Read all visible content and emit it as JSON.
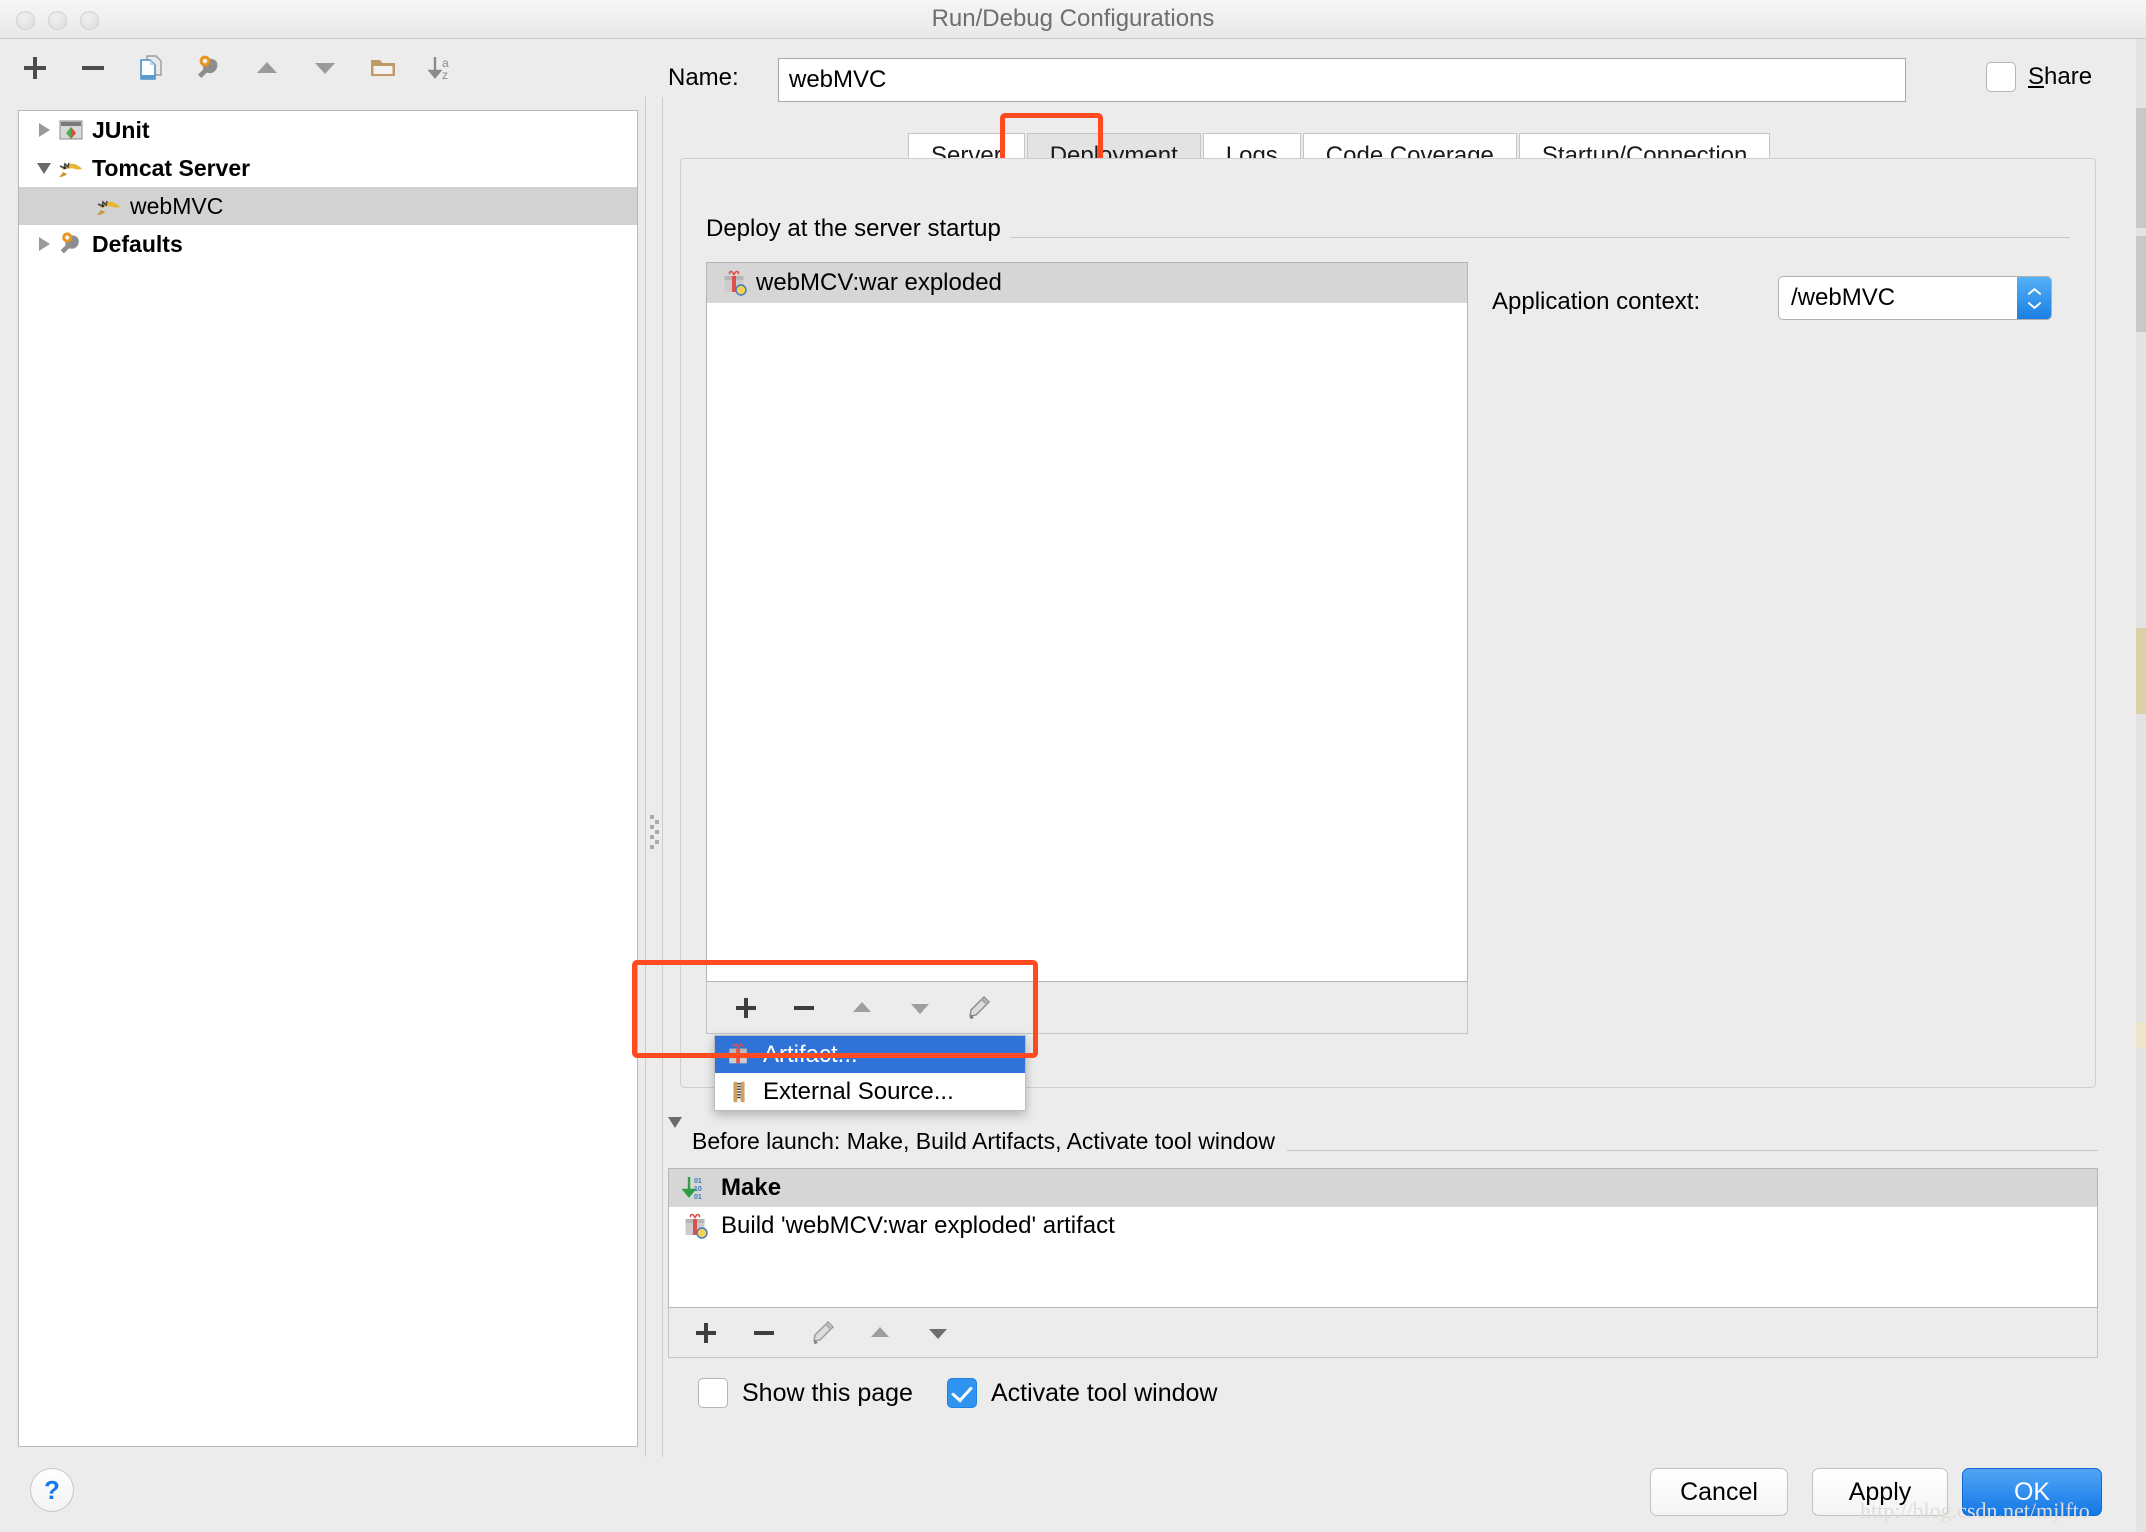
{
  "window": {
    "title": "Run/Debug Configurations",
    "traffic_lights": [
      "close-button",
      "minimize-button",
      "zoom-button"
    ]
  },
  "left_toolbar": {
    "buttons": [
      {
        "name": "add-configuration-button",
        "icon": "plus-icon",
        "label": "+"
      },
      {
        "name": "remove-configuration-button",
        "icon": "minus-icon",
        "label": "−"
      },
      {
        "name": "copy-configuration-button",
        "icon": "copy-icon",
        "label": "Copy Configuration"
      },
      {
        "name": "edit-defaults-button",
        "icon": "wrench-icon",
        "label": "Edit defaults"
      },
      {
        "name": "move-up-button",
        "icon": "triangle-up-icon",
        "label": "Move Up"
      },
      {
        "name": "move-down-button",
        "icon": "triangle-down-icon",
        "label": "Move Down"
      },
      {
        "name": "create-folder-button",
        "icon": "folder-icon",
        "label": "Create New Folder"
      },
      {
        "name": "sort-configurations-button",
        "icon": "sort-az-icon",
        "label": "Sort Configurations"
      }
    ]
  },
  "tree": {
    "items": [
      {
        "label": "JUnit",
        "icon": "junit-icon",
        "twisty": "right",
        "indent": 0,
        "bold": true,
        "selected": false
      },
      {
        "label": "Tomcat Server",
        "icon": "tomcat-icon",
        "twisty": "down",
        "indent": 0,
        "bold": true,
        "selected": false
      },
      {
        "label": "webMVC",
        "icon": "tomcat-icon",
        "twisty": "none",
        "indent": 1,
        "bold": false,
        "selected": true
      },
      {
        "label": "Defaults",
        "icon": "wrench-icon",
        "twisty": "right",
        "indent": 0,
        "bold": true,
        "selected": false
      }
    ]
  },
  "name_row": {
    "label": "Name:",
    "value": "webMVC",
    "placeholder": "",
    "share_label_prefix": "",
    "share_mnemonic": "S",
    "share_label_rest": "hare",
    "share_checked": false
  },
  "tabs": [
    {
      "label": "Server",
      "active": false
    },
    {
      "label": "Deployment",
      "active": true,
      "highlighted": true
    },
    {
      "label": "Logs",
      "active": false
    },
    {
      "label": "Code Coverage",
      "active": false
    },
    {
      "label": "Startup/Connection",
      "active": false
    }
  ],
  "deployment": {
    "section_title": "Deploy at the server startup",
    "items": [
      {
        "label": "webMCV:war exploded",
        "icon": "artifact-icon",
        "selected": true
      }
    ],
    "toolbar": [
      {
        "name": "add-artifact-button",
        "icon": "plus-icon"
      },
      {
        "name": "remove-artifact-button",
        "icon": "minus-icon"
      },
      {
        "name": "move-artifact-up-button",
        "icon": "triangle-up-icon"
      },
      {
        "name": "move-artifact-down-button",
        "icon": "triangle-down-icon"
      },
      {
        "name": "edit-artifact-button",
        "icon": "pencil-icon"
      }
    ],
    "application_context": {
      "label": "Application context:",
      "value": "/webMVC"
    }
  },
  "popup_menu": {
    "items": [
      {
        "label": "Artifact...",
        "icon": "artifact-icon",
        "selected": true
      },
      {
        "label": "External Source...",
        "icon": "external-source-icon",
        "selected": false
      }
    ]
  },
  "before_launch": {
    "header": "Before launch: Make, Build Artifacts, Activate tool window",
    "rows": [
      {
        "label": "Make",
        "icon": "make-icon",
        "selected": true
      },
      {
        "label": "Build 'webMCV:war exploded' artifact",
        "icon": "artifact-icon",
        "selected": false
      }
    ],
    "toolbar": [
      {
        "name": "add-task-button",
        "icon": "plus-icon"
      },
      {
        "name": "remove-task-button",
        "icon": "minus-icon"
      },
      {
        "name": "edit-task-button",
        "icon": "pencil-icon"
      },
      {
        "name": "move-task-up-button",
        "icon": "triangle-up-icon"
      },
      {
        "name": "move-task-down-button",
        "icon": "triangle-down-icon"
      }
    ],
    "checkboxes": [
      {
        "label": "Show this page",
        "checked": false
      },
      {
        "label": "Activate tool window",
        "checked": true
      }
    ]
  },
  "footer": {
    "help_glyph": "?",
    "cancel_label": "Cancel",
    "apply_label": "Apply",
    "ok_label": "OK"
  },
  "watermark": "http://blog.csdn.net/mjlfto",
  "colors": {
    "accent_blue": "#1478e8",
    "selection_blue": "#2f72d8",
    "highlight_red": "#ff4b1f",
    "panel_bg": "#ececec",
    "row_selected_gray": "#d6d6d6"
  }
}
